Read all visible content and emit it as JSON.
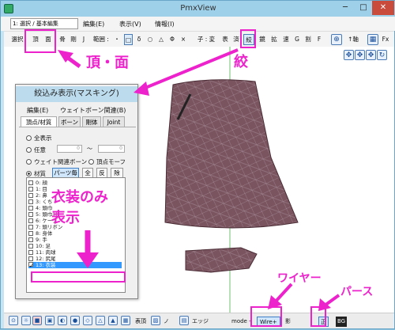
{
  "window": {
    "title": "PmxView"
  },
  "menubar": {
    "mode_select": "1: 選択 / 基本編集",
    "items": [
      "編集(E)",
      "表示(V)",
      "情報(I)"
    ]
  },
  "toolbar": {
    "select_label": "選択",
    "vertex_label": "頂",
    "face_label": "面",
    "bone_label": "骨",
    "rigid_label": "剛",
    "joint_label": "J",
    "range_label": "範囲 :",
    "shapes": [
      "・",
      "□",
      "δ",
      "○",
      "△",
      "Φ",
      "×"
    ],
    "coord_label": "子 : 変",
    "pattern_buttons": [
      "表",
      "済",
      "絞",
      "鏡",
      "拡",
      "速",
      "G",
      "割",
      "F"
    ],
    "rotate_label": "↑軸",
    "fx_label": "Fx"
  },
  "panel": {
    "title": "絞込み表示(マスキング)",
    "menu_items": [
      "編集(E)",
      "ウェイトボーン関連(B)"
    ],
    "tabs": [
      "頂点/材質",
      "ボーン",
      "剛体",
      "Joint"
    ],
    "radios": [
      "全表示",
      "任意",
      "ウェイト関連ボーン",
      "頂点モーフ",
      "材質"
    ],
    "range_from": "0",
    "range_tilde": "～",
    "range_to": "0",
    "material_buttons": [
      "パーツ毎",
      "全",
      "反",
      "除"
    ],
    "materials": [
      "0: 顔",
      "1: 目",
      "2: 鼻",
      "3: くち",
      "4: 頭巾",
      "5: 頭巾耳",
      "6: ケープ",
      "7: 頭リボン",
      "8: 身体",
      "9: 手",
      "10: 足",
      "11: 肉球",
      "12: 尻尾",
      "13: 衣装"
    ],
    "checked_index": 13
  },
  "statusbar": {
    "items": [
      "表頂",
      "ノ",
      "エッジ",
      "mode -",
      "Wire+",
      "影",
      "正",
      "BG"
    ]
  },
  "annotations": {
    "vertex_face": "頂・面",
    "pattern": "絞",
    "costume_only_1": "衣装のみ",
    "costume_only_2": "表示",
    "wire": "ワイヤー",
    "perspective": "パース"
  },
  "colors": {
    "accent": "#ee22cc",
    "mesh": "#7a5560",
    "selection": "#3399ff"
  }
}
